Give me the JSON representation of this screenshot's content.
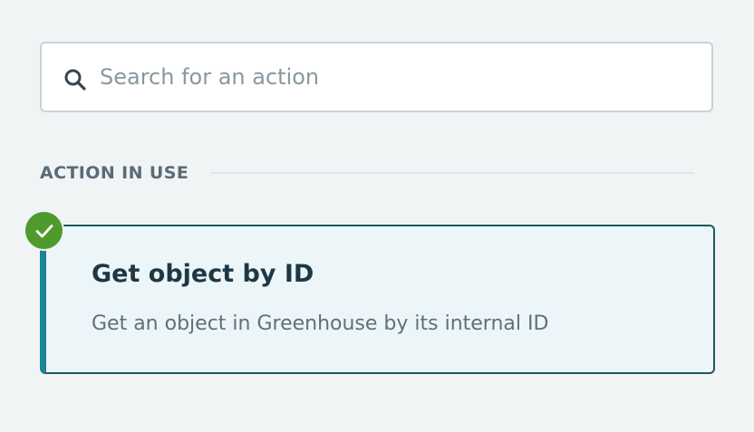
{
  "search": {
    "placeholder": "Search for an action",
    "value": "",
    "icon": "search-icon"
  },
  "section": {
    "title": "ACTION IN USE"
  },
  "action_card": {
    "title": "Get object by ID",
    "description": "Get an object in Greenhouse by its internal ID",
    "status_icon": "check-circle-icon",
    "selected": true
  },
  "colors": {
    "background": "#f1f4f5",
    "card_background": "#ecf5f8",
    "card_accent": "#1b8395",
    "check_green": "#4e9a2c",
    "title_text": "#1d3844",
    "muted_text": "#5f707c"
  }
}
